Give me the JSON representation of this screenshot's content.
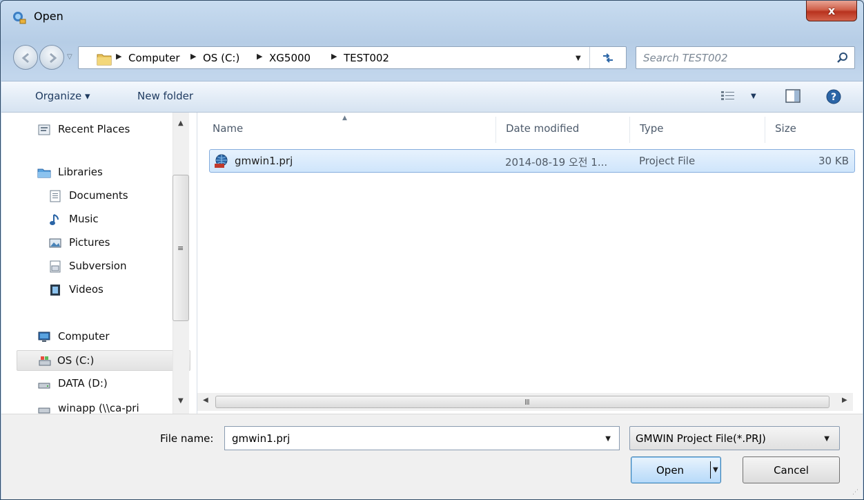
{
  "window": {
    "title": "Open",
    "close_label": "x"
  },
  "address": {
    "crumbs": [
      "Computer",
      "OS (C:)",
      "XG5000",
      "TEST002"
    ]
  },
  "search": {
    "placeholder": "Search TEST002"
  },
  "toolbar": {
    "organize_label": "Organize ▾",
    "new_folder_label": "New folder"
  },
  "navpane": {
    "items": [
      {
        "label": "Recent Places",
        "icon": "recent-places-icon"
      },
      {
        "label": "Libraries",
        "icon": "libraries-icon"
      },
      {
        "label": "Documents",
        "icon": "documents-icon"
      },
      {
        "label": "Music",
        "icon": "music-icon"
      },
      {
        "label": "Pictures",
        "icon": "pictures-icon"
      },
      {
        "label": "Subversion",
        "icon": "subversion-icon"
      },
      {
        "label": "Videos",
        "icon": "videos-icon"
      },
      {
        "label": "Computer",
        "icon": "computer-icon"
      },
      {
        "label": "OS (C:)",
        "icon": "drive-icon",
        "selected": true
      },
      {
        "label": "DATA (D:)",
        "icon": "drive-icon"
      },
      {
        "label": "winapp (\\\\ca-pri",
        "icon": "network-drive-icon"
      }
    ]
  },
  "filelist": {
    "columns": [
      "Name",
      "Date modified",
      "Type",
      "Size"
    ],
    "rows": [
      {
        "name": "gmwin1.prj",
        "date": "2014-08-19 오전 1...",
        "type": "Project File",
        "size": "30 KB",
        "selected": true
      }
    ],
    "scroll_grip": "III"
  },
  "bottom": {
    "filename_label": "File name:",
    "filename_value": "gmwin1.prj",
    "filter_value": "GMWIN Project File(*.PRJ)",
    "open_label": "Open",
    "cancel_label": "Cancel"
  },
  "colors": {
    "selection": "#cfe5fb",
    "selection_border": "#84acdd",
    "close": "#c7432c"
  }
}
